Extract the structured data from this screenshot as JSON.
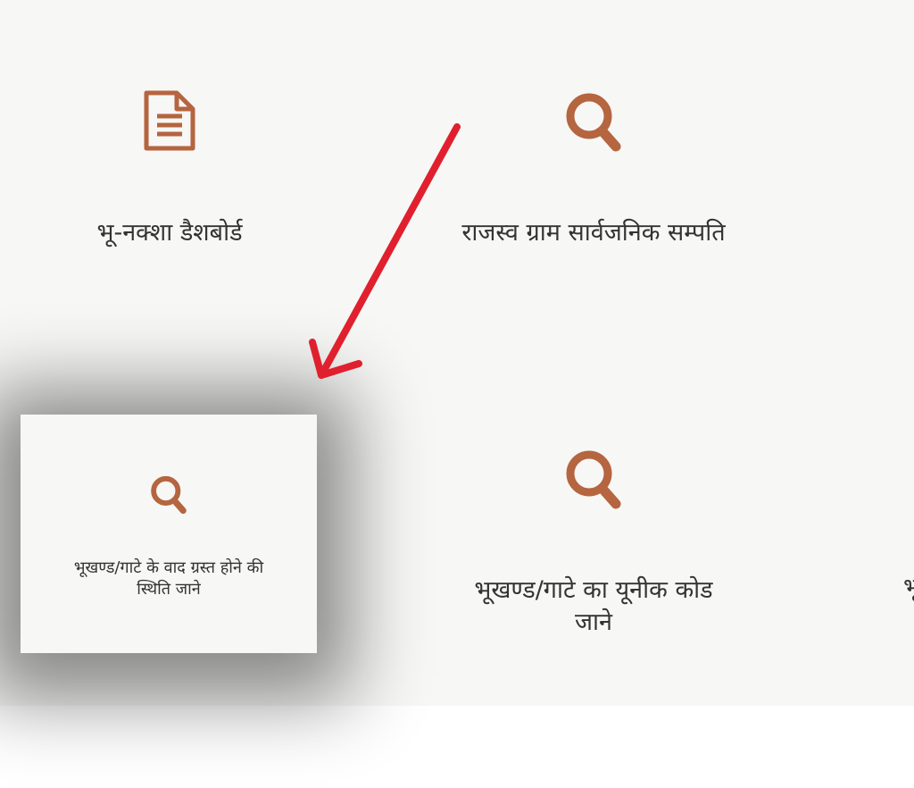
{
  "colors": {
    "icon": "#b5653f",
    "text": "#333333",
    "panel_background": "#f7f7f5",
    "annotation_arrow": "#e0202e"
  },
  "tiles": [
    {
      "label": "भू-नक्शा डैशबोर्ड",
      "icon": "document-icon"
    },
    {
      "label": "राजस्व ग्राम सार्वजनिक सम्पति",
      "icon": "search-icon"
    },
    {
      "label": "भूखण्ड/गाटे के वाद ग्रस्त होने की स्थिति जाने",
      "icon": "search-icon",
      "highlighted": true
    },
    {
      "label": "भूखण्ड/गाटे का यूनीक कोड जाने",
      "icon": "search-icon"
    },
    {
      "label": "भू",
      "icon": "search-icon"
    }
  ]
}
